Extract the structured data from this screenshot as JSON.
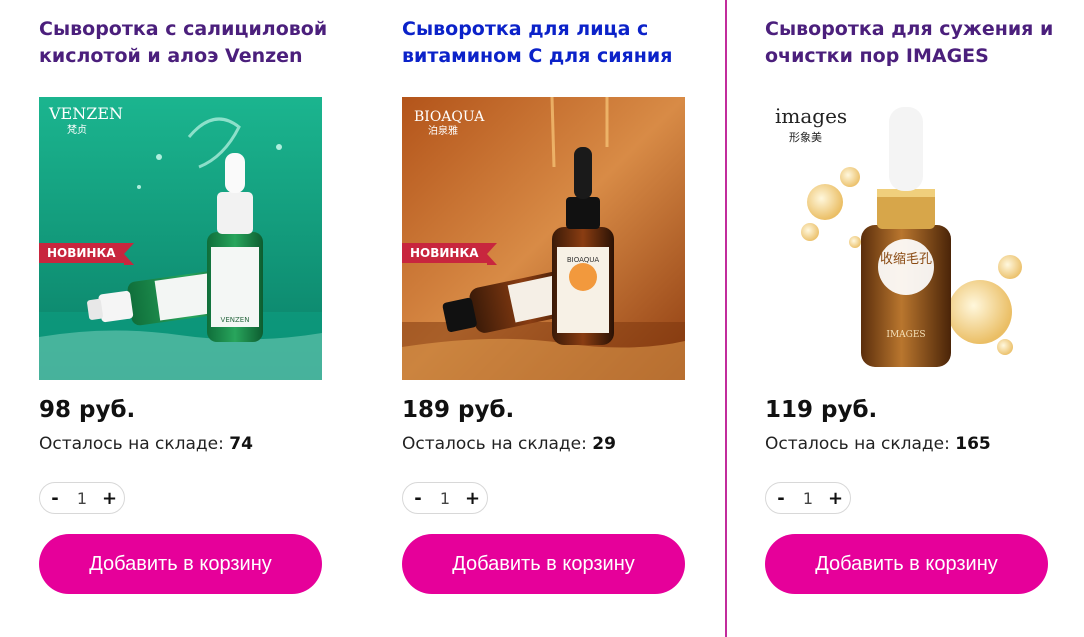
{
  "products": [
    {
      "title": "Сыворотка с салициловой кислотой и алоэ Venzen",
      "title_color": "#4b1f7c",
      "brand": "VENZEN",
      "brand_sub": "梵贞",
      "badge": "НОВИНКА",
      "price": "98 руб.",
      "stock_label": "Осталось на складе:",
      "stock": "74",
      "qty": "1",
      "minus": "-",
      "plus": "+",
      "cart_label": "Добавить в корзину"
    },
    {
      "title": "Сыворотка для лица с витамином С для сияния",
      "title_color": "#0b22c9",
      "brand": "BIOAQUA",
      "brand_sub": "泊泉雅",
      "badge": "НОВИНКА",
      "price": "189 руб.",
      "stock_label": "Осталось на складе:",
      "stock": "29",
      "qty": "1",
      "minus": "-",
      "plus": "+",
      "cart_label": "Добавить в корзину"
    },
    {
      "title": "Сыворотка для сужения и очистки пор IMAGES",
      "title_color": "#4b1f7c",
      "brand": "images",
      "brand_sub": "形象美",
      "bottle_text": "收缩毛孔",
      "bottle_brand": "IMAGES",
      "price": "119 руб.",
      "stock_label": "Осталось на складе:",
      "stock": "165",
      "qty": "1",
      "minus": "-",
      "plus": "+",
      "cart_label": "Добавить в корзину"
    }
  ],
  "colors": {
    "accent": "#e6009a",
    "divider": "#c22c9c",
    "badge": "#c8263e"
  }
}
